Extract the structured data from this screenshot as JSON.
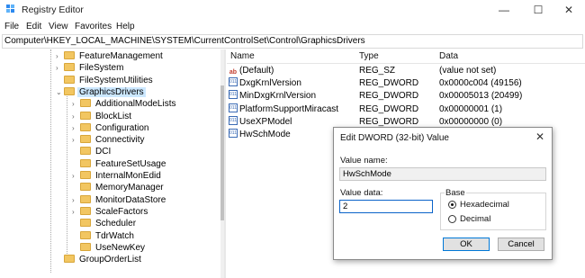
{
  "window": {
    "title": "Registry Editor",
    "minimize": "—",
    "maximize": "☐",
    "close": "✕"
  },
  "menu": [
    "File",
    "Edit",
    "View",
    "Favorites",
    "Help"
  ],
  "address": "Computer\\HKEY_LOCAL_MACHINE\\SYSTEM\\CurrentControlSet\\Control\\GraphicsDrivers",
  "tree": {
    "items": [
      {
        "label": "FeatureManagement",
        "expandable": true,
        "level": 0
      },
      {
        "label": "FileSystem",
        "expandable": true,
        "level": 0
      },
      {
        "label": "FileSystemUtilities",
        "expandable": false,
        "level": 0
      },
      {
        "label": "GraphicsDrivers",
        "expandable": true,
        "expanded": true,
        "selected": true,
        "level": 0
      },
      {
        "label": "AdditionalModeLists",
        "expandable": true,
        "level": 1
      },
      {
        "label": "BlockList",
        "expandable": true,
        "level": 1
      },
      {
        "label": "Configuration",
        "expandable": true,
        "level": 1
      },
      {
        "label": "Connectivity",
        "expandable": true,
        "level": 1
      },
      {
        "label": "DCI",
        "expandable": false,
        "level": 1
      },
      {
        "label": "FeatureSetUsage",
        "expandable": false,
        "level": 1
      },
      {
        "label": "InternalMonEdid",
        "expandable": true,
        "level": 1
      },
      {
        "label": "MemoryManager",
        "expandable": false,
        "level": 1
      },
      {
        "label": "MonitorDataStore",
        "expandable": true,
        "level": 1
      },
      {
        "label": "ScaleFactors",
        "expandable": true,
        "level": 1
      },
      {
        "label": "Scheduler",
        "expandable": false,
        "level": 1
      },
      {
        "label": "TdrWatch",
        "expandable": false,
        "level": 1
      },
      {
        "label": "UseNewKey",
        "expandable": false,
        "level": 1
      },
      {
        "label": "GroupOrderList",
        "expandable": false,
        "level": 0
      }
    ]
  },
  "list": {
    "headers": {
      "name": "Name",
      "type": "Type",
      "data": "Data"
    },
    "rows": [
      {
        "icon": "string-value-icon",
        "glyph": "ab",
        "name": "(Default)",
        "type": "REG_SZ",
        "data": "(value not set)"
      },
      {
        "icon": "binary-value-icon",
        "glyph": "011",
        "name": "DxgKrnlVersion",
        "type": "REG_DWORD",
        "data": "0x0000c004 (49156)"
      },
      {
        "icon": "binary-value-icon",
        "glyph": "011",
        "name": "MinDxgKrnlVersion",
        "type": "REG_DWORD",
        "data": "0x00005013 (20499)"
      },
      {
        "icon": "binary-value-icon",
        "glyph": "011",
        "name": "PlatformSupportMiracast",
        "type": "REG_DWORD",
        "data": "0x00000001 (1)"
      },
      {
        "icon": "binary-value-icon",
        "glyph": "011",
        "name": "UseXPModel",
        "type": "REG_DWORD",
        "data": "0x00000000 (0)"
      },
      {
        "icon": "binary-value-icon",
        "glyph": "011",
        "name": "HwSchMode",
        "type": "",
        "data": ""
      }
    ]
  },
  "dialog": {
    "title": "Edit DWORD (32-bit) Value",
    "close": "✕",
    "value_name_label": "Value name:",
    "value_name": "HwSchMode",
    "value_data_label": "Value data:",
    "value_data": "2",
    "base_label": "Base",
    "base_options": [
      {
        "label": "Hexadecimal",
        "checked": true
      },
      {
        "label": "Decimal",
        "checked": false
      }
    ],
    "ok": "OK",
    "cancel": "Cancel"
  },
  "colors": {
    "selection": "#cce8ff",
    "folder": "#f2c661",
    "accent": "#0078d7"
  }
}
